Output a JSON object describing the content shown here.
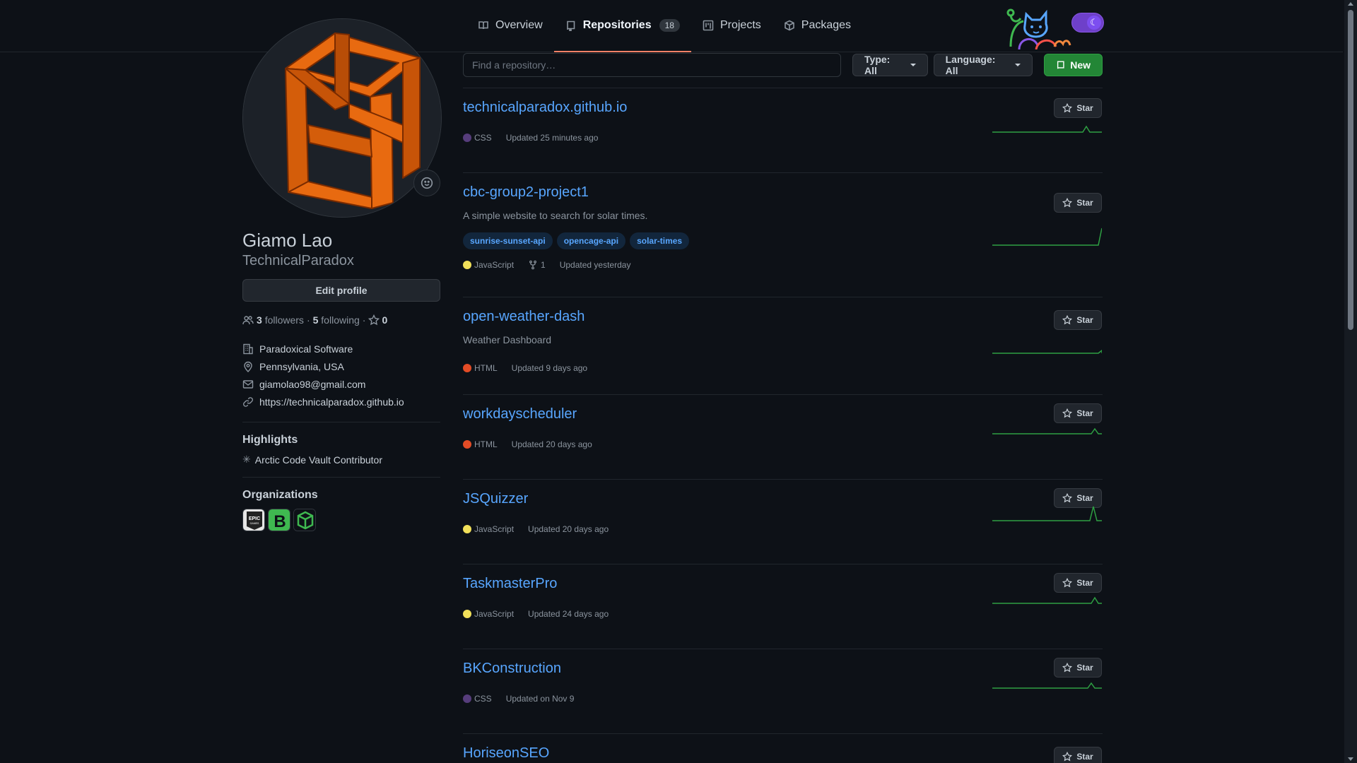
{
  "nav": {
    "tabs": [
      {
        "label": "Overview",
        "icon": "book-icon"
      },
      {
        "label": "Repositories",
        "icon": "repo-icon",
        "count": "18",
        "active": true
      },
      {
        "label": "Projects",
        "icon": "project-icon"
      },
      {
        "label": "Packages",
        "icon": "package-icon"
      }
    ]
  },
  "profile": {
    "name": "Giamo Lao",
    "username": "TechnicalParadox",
    "edit_label": "Edit profile",
    "followers_count": "3",
    "followers_label": "followers",
    "following_count": "5",
    "following_label": "following",
    "stars_count": "0",
    "company": "Paradoxical Software",
    "location": "Pennsylvania, USA",
    "email": "giamolao98@gmail.com",
    "website": "https://technicalparadox.github.io"
  },
  "highlights": {
    "title": "Highlights",
    "items": [
      "Arctic Code Vault Contributor"
    ]
  },
  "organizations": {
    "title": "Organizations",
    "items": [
      "Epic Games",
      "B",
      "Cube"
    ]
  },
  "filters": {
    "search_placeholder": "Find a repository…",
    "type_label": "Type: All",
    "language_label": "Language: All",
    "new_label": "New"
  },
  "colors": {
    "accent_link": "#58a6ff",
    "css": "#563d7c",
    "javascript": "#f1e05a",
    "html": "#e34c26",
    "sparkline": "#2ea043",
    "new_button": "#238636"
  },
  "repos": [
    {
      "name": "technicalparadox.github.io",
      "description": "",
      "topics": [],
      "language": "CSS",
      "forks": "",
      "updated": "Updated 25 minutes ago",
      "star_label": "Star"
    },
    {
      "name": "cbc-group2-project1",
      "description": "A simple website to search for solar times.",
      "topics": [
        "sunrise-sunset-api",
        "opencage-api",
        "solar-times"
      ],
      "language": "JavaScript",
      "forks": "1",
      "updated": "Updated yesterday",
      "star_label": "Star"
    },
    {
      "name": "open-weather-dash",
      "description": "Weather Dashboard",
      "topics": [],
      "language": "HTML",
      "forks": "",
      "updated": "Updated 9 days ago",
      "star_label": "Star"
    },
    {
      "name": "workdayscheduler",
      "description": "",
      "topics": [],
      "language": "HTML",
      "forks": "",
      "updated": "Updated 20 days ago",
      "star_label": "Star"
    },
    {
      "name": "JSQuizzer",
      "description": "",
      "topics": [],
      "language": "JavaScript",
      "forks": "",
      "updated": "Updated 20 days ago",
      "star_label": "Star"
    },
    {
      "name": "TaskmasterPro",
      "description": "",
      "topics": [],
      "language": "JavaScript",
      "forks": "",
      "updated": "Updated 24 days ago",
      "star_label": "Star"
    },
    {
      "name": "BKConstruction",
      "description": "",
      "topics": [],
      "language": "CSS",
      "forks": "",
      "updated": "Updated on Nov 9",
      "star_label": "Star"
    },
    {
      "name": "HoriseonSEO",
      "description": "",
      "topics": [],
      "language": "",
      "forks": "",
      "updated": "",
      "star_label": "Star"
    }
  ]
}
